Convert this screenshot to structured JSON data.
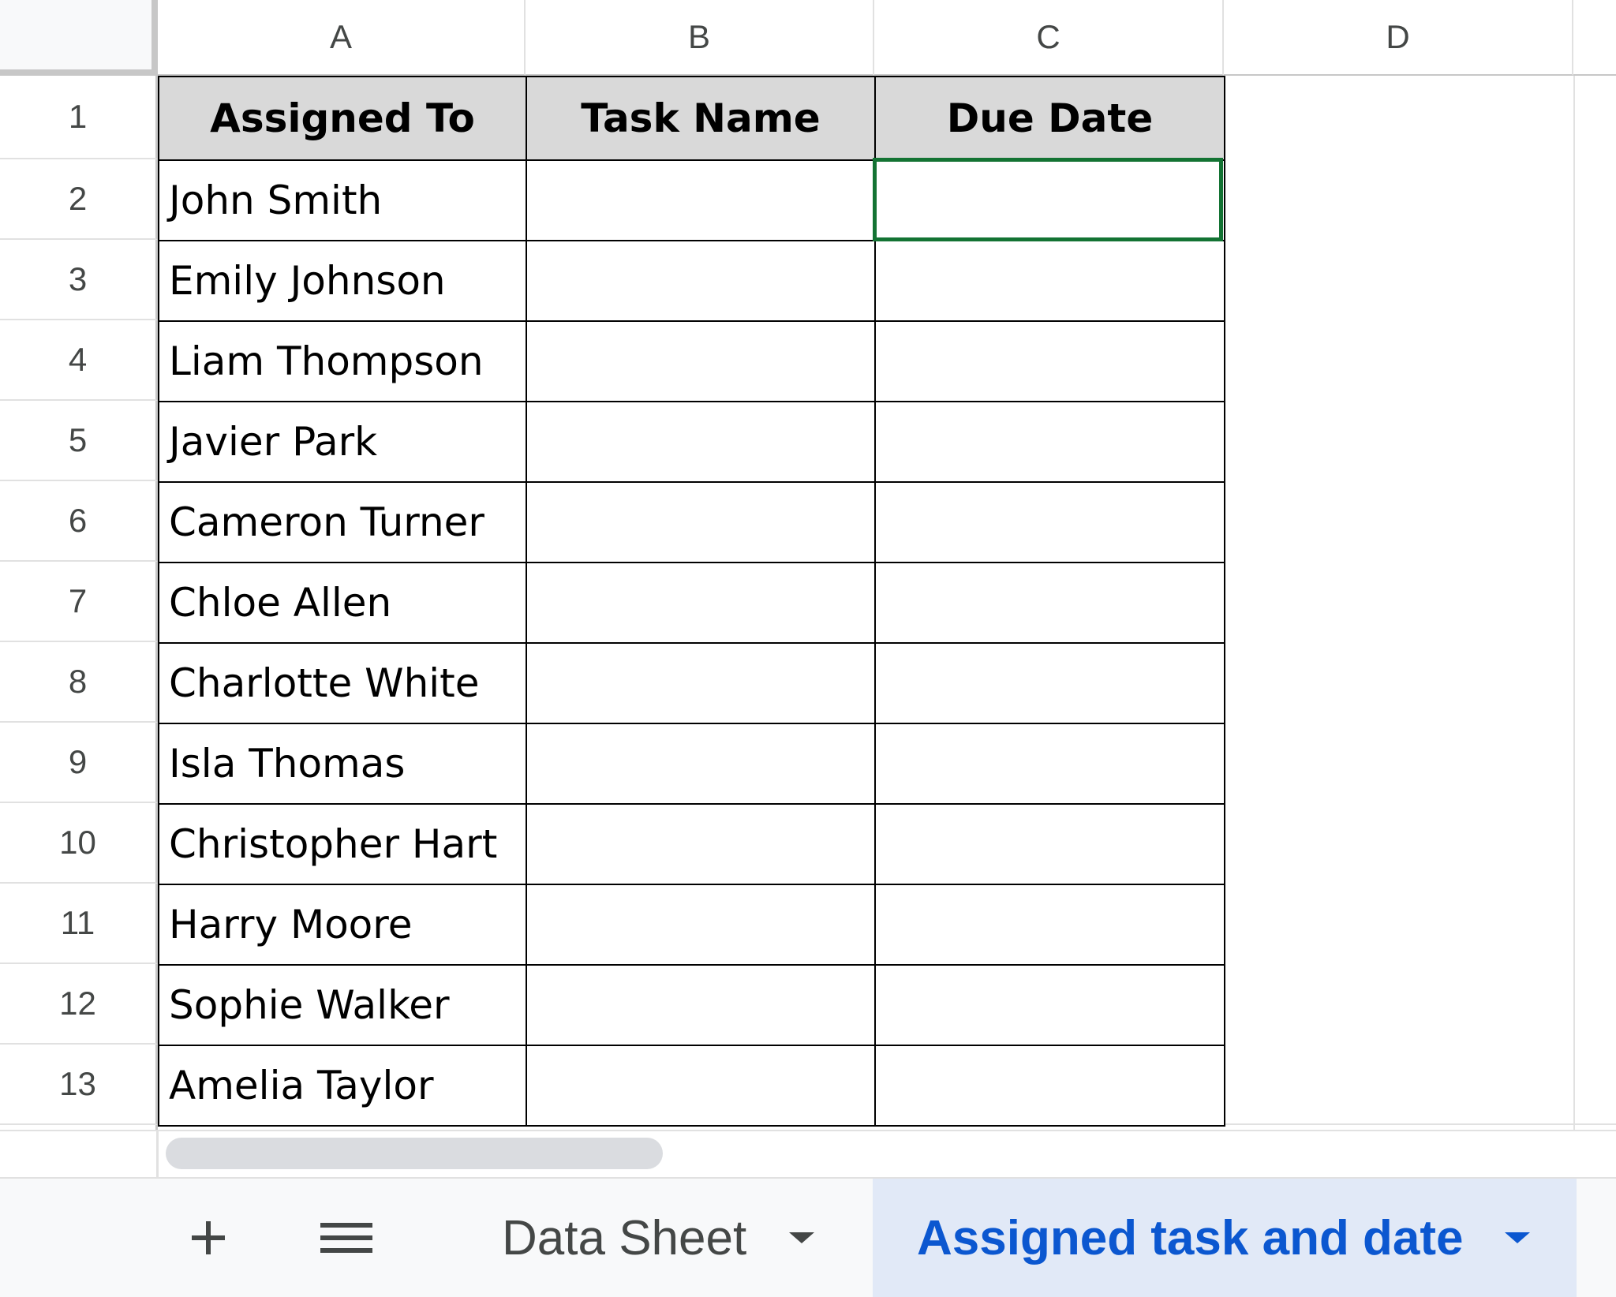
{
  "columns": [
    "A",
    "B",
    "C",
    "D"
  ],
  "rows": [
    "1",
    "2",
    "3",
    "4",
    "5",
    "6",
    "7",
    "8",
    "9",
    "10",
    "11",
    "12",
    "13"
  ],
  "table": {
    "headers": [
      "Assigned To",
      "Task Name",
      "Due Date"
    ],
    "assignees": [
      "John Smith",
      "Emily Johnson",
      "Liam Thompson",
      "Javier Park",
      "Cameron Turner",
      "Chloe Allen",
      "Charlotte White",
      "Isla Thomas",
      "Christopher Hart",
      "Harry Moore",
      "Sophie Walker",
      "Amelia Taylor"
    ]
  },
  "selected_cell": "C2",
  "tabs": [
    {
      "label": "Data Sheet",
      "active": false
    },
    {
      "label": "Assigned task and date",
      "active": true
    }
  ],
  "icons": {
    "add": "plus-icon",
    "all_sheets": "hamburger-menu-icon",
    "tab_menu": "caret-down-icon"
  },
  "colors": {
    "selection": "#137333",
    "header_fill": "#d9d9d9",
    "active_tab_bg": "#e1e9f7",
    "active_tab_text": "#0b57d0"
  }
}
